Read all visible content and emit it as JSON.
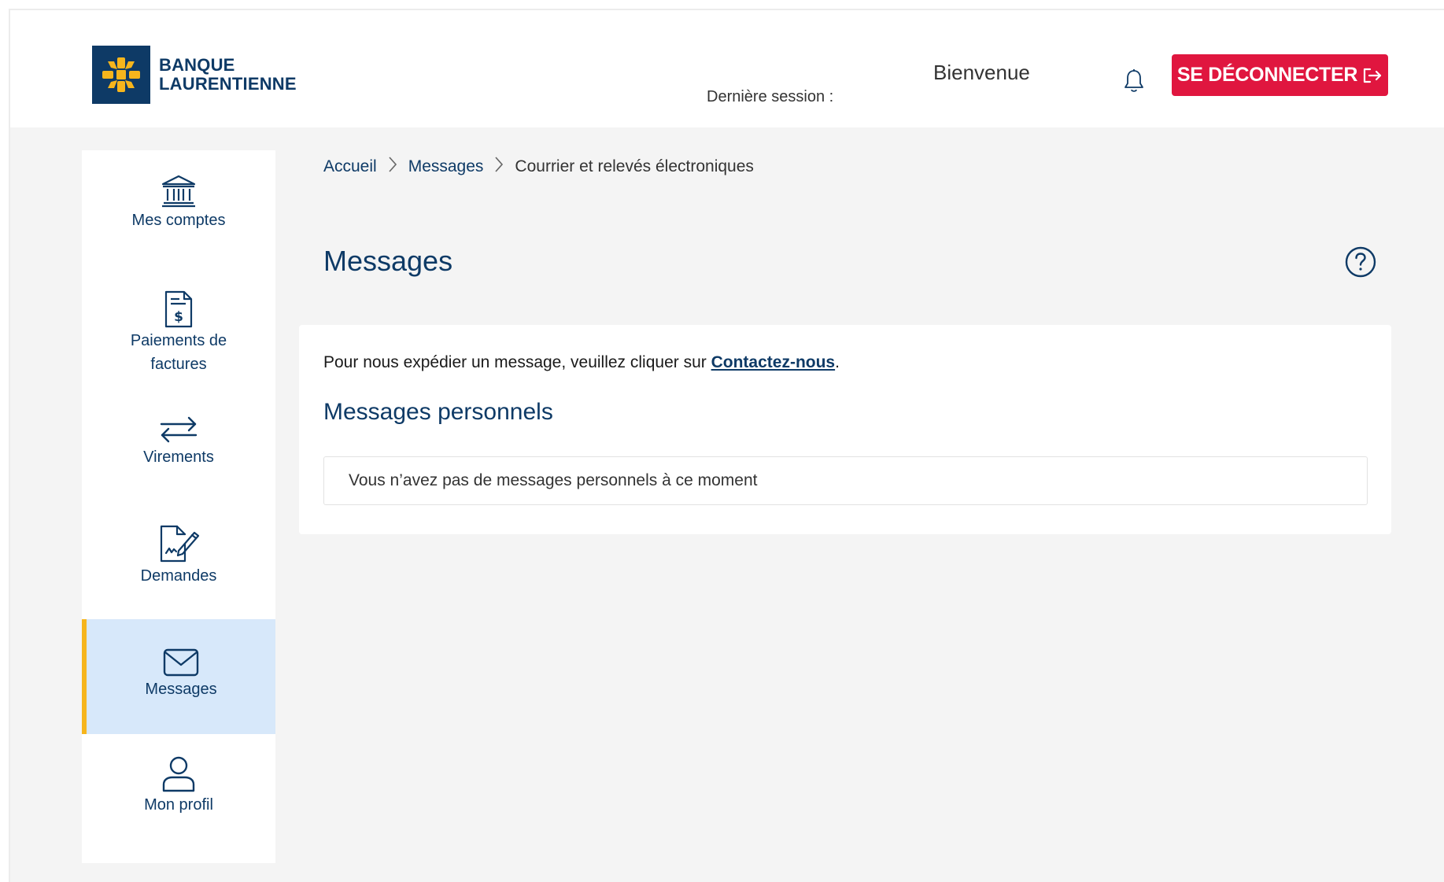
{
  "header": {
    "bank_name_line1": "BANQUE",
    "bank_name_line2": "LAURENTIENNE",
    "last_session_label": "Dernière session :",
    "welcome_text": "Bienvenue",
    "notifications_icon": "bell-icon",
    "logout_label": "SE DÉCONNECTER",
    "logout_icon": "logout-arrow-icon",
    "logout_color": "#e0163f",
    "brand_color": "#0e3a66",
    "logo_accent_color": "#f6b51c"
  },
  "sidebar": {
    "items": [
      {
        "label": "Mes comptes",
        "icon": "bank-icon",
        "active": false
      },
      {
        "label_line1": "Paiements de",
        "label_line2": "factures",
        "icon": "invoice-dollar-icon",
        "active": false
      },
      {
        "label": "Virements",
        "icon": "transfer-arrows-icon",
        "active": false
      },
      {
        "label": "Demandes",
        "icon": "document-signature-icon",
        "active": false
      },
      {
        "label": "Messages",
        "icon": "envelope-icon",
        "active": true
      },
      {
        "label": "Mon profil",
        "icon": "user-icon",
        "active": false
      }
    ],
    "active_bg": "#d7e8fa",
    "active_accent": "#f6b51c"
  },
  "breadcrumb": {
    "items": [
      "Accueil",
      "Messages",
      "Courrier et relevés électroniques"
    ]
  },
  "main": {
    "title": "Messages",
    "help_icon": "help-question-icon",
    "info_prefix": "Pour nous expédier un message, veuillez cliquer sur ",
    "info_link": "Contactez-nous",
    "info_suffix": ".",
    "section_title": "Messages personnels",
    "empty_message": "Vous n’avez pas de messages personnels à ce moment"
  }
}
